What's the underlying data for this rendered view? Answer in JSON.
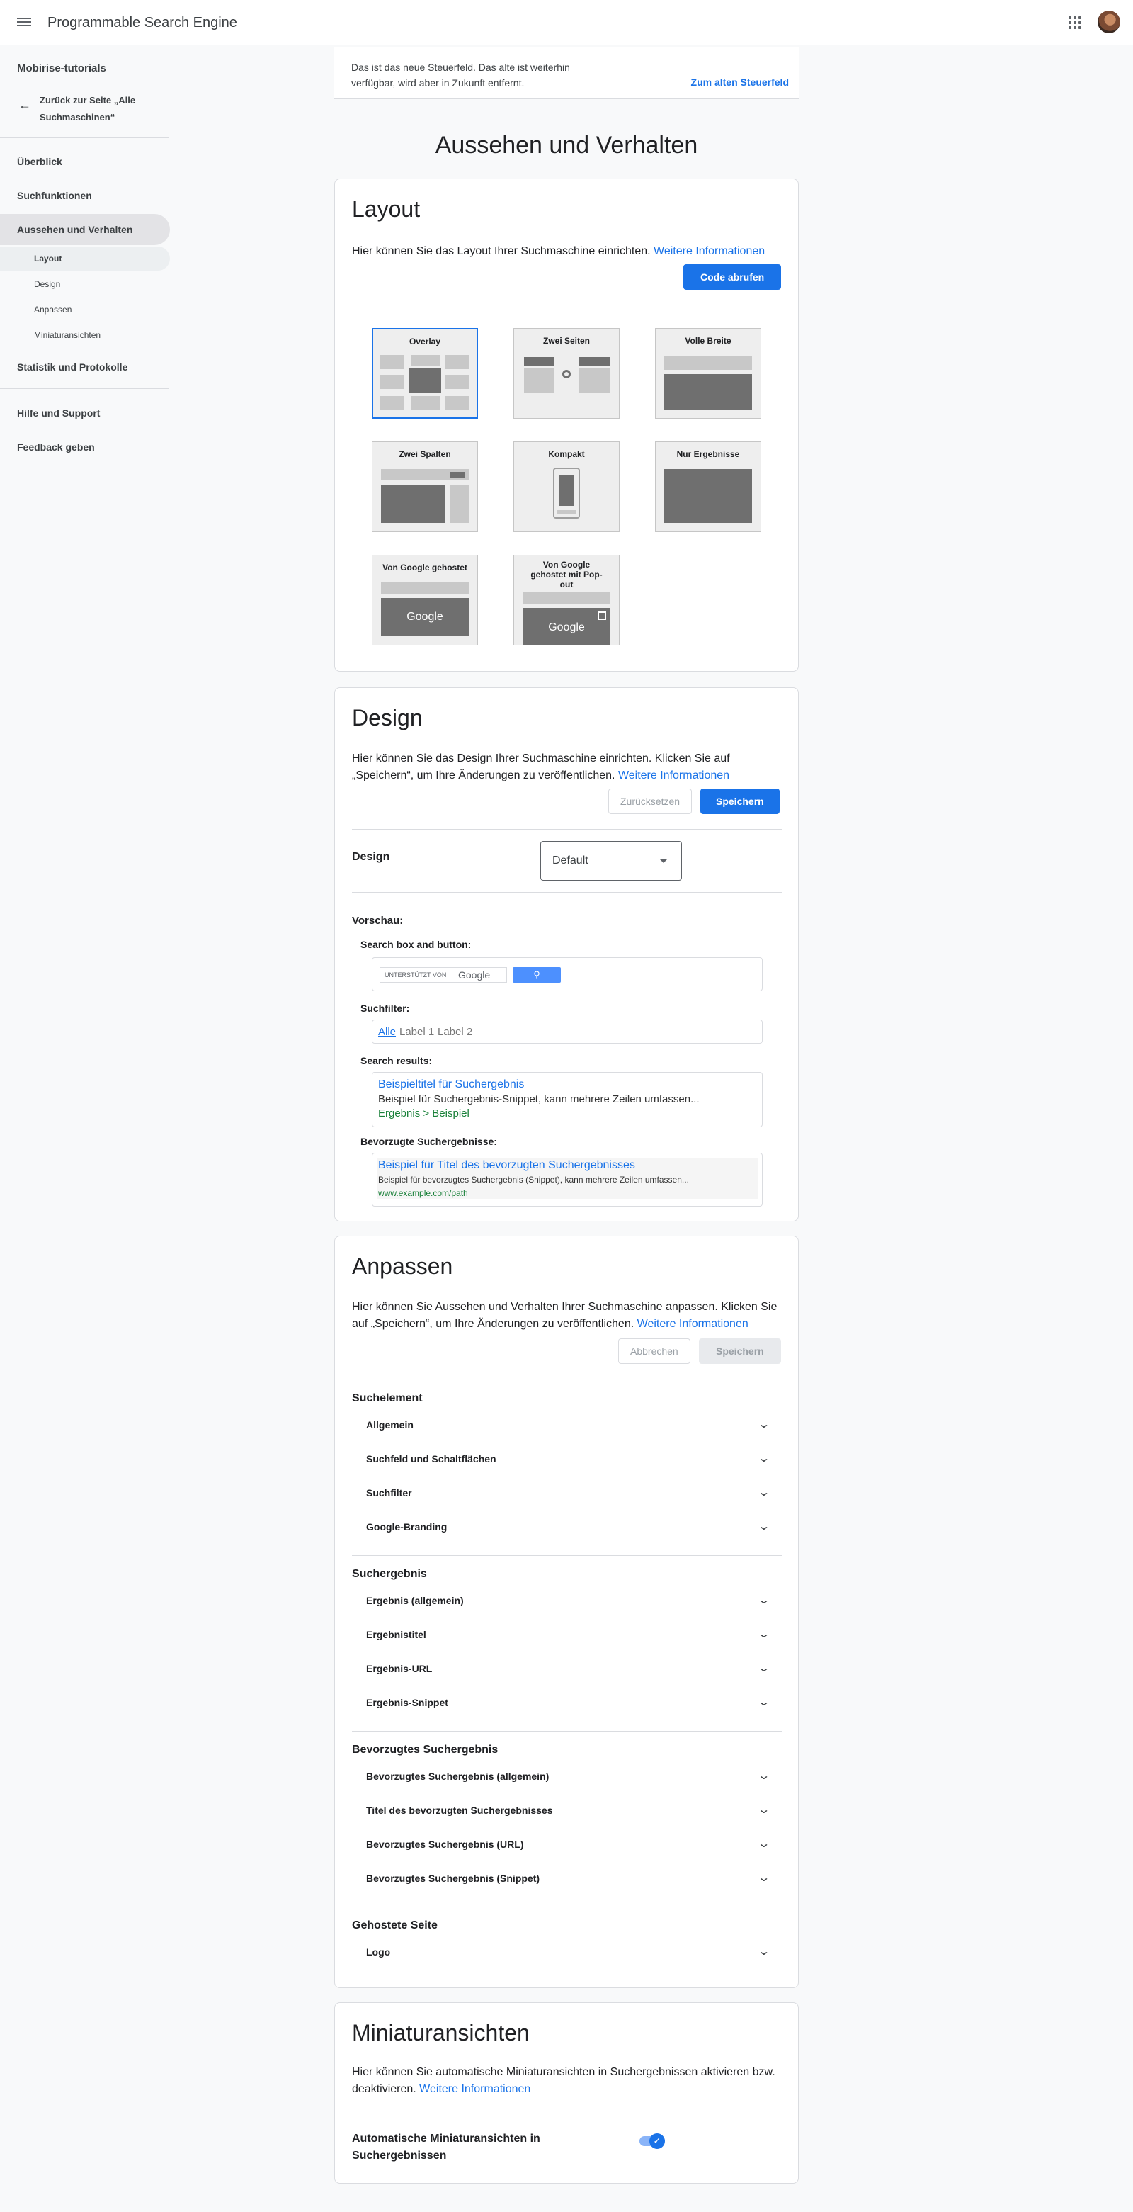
{
  "header": {
    "title": "Programmable Search Engine",
    "menu_icon": "menu-icon",
    "apps_icon": "apps-icon"
  },
  "sidebar": {
    "project": "Mobirise-tutorials",
    "back_label": "Zurück zur Seite „Alle Suchmaschinen“",
    "items": [
      {
        "label": "Überblick"
      },
      {
        "label": "Suchfunktionen"
      },
      {
        "label": "Aussehen und Verhalten"
      },
      {
        "label": "Statistik und Protokolle"
      },
      {
        "label": "Hilfe und Support"
      },
      {
        "label": "Feedback geben"
      }
    ],
    "subitems": [
      {
        "label": "Layout"
      },
      {
        "label": "Design"
      },
      {
        "label": "Anpassen"
      },
      {
        "label": "Miniaturansichten"
      }
    ]
  },
  "banner": {
    "text": "Das ist das neue Steuerfeld. Das alte ist weiterhin verfügbar, wird aber in Zukunft entfernt.",
    "link": "Zum alten Steuerfeld"
  },
  "page": {
    "title": "Aussehen und Verhalten"
  },
  "layout": {
    "title": "Layout",
    "desc": "Hier können Sie das Layout Ihrer Suchmaschine einrichten.",
    "more": "Weitere Informationen",
    "button": "Code abrufen",
    "tiles": [
      {
        "label": "Overlay"
      },
      {
        "label": "Zwei Seiten"
      },
      {
        "label": "Volle Breite"
      },
      {
        "label": "Zwei Spalten"
      },
      {
        "label": "Kompakt"
      },
      {
        "label": "Nur Ergebnisse"
      },
      {
        "label": "Von Google gehostet"
      },
      {
        "label": "Von Google gehostet mit Pop-out"
      }
    ],
    "google_word": "Google",
    "selected": "Overlay"
  },
  "design": {
    "title": "Design",
    "desc": "Hier können Sie das Design Ihrer Suchmaschine einrichten. Klicken Sie auf „Speichern“, um Ihre Änderungen zu veröffentlichen.",
    "more": "Weitere Informationen",
    "reset": "Zurücksetzen",
    "save": "Speichern",
    "field_label": "Design",
    "select_value": "Default",
    "preview_label": "Vorschau:",
    "searchbox_label": "Search box and button:",
    "powered_by": "UNTERSTÜTZT VON",
    "google_word": "Google",
    "filter_label": "Suchfilter:",
    "filters": [
      "Alle",
      "Label 1",
      "Label 2"
    ],
    "results_label": "Search results:",
    "result_title": "Beispieltitel für Suchergebnis",
    "result_snippet": "Beispiel für Suchergebnis-Snippet, kann mehrere Zeilen umfassen...",
    "result_url": "Ergebnis > Beispiel",
    "promo_label": "Bevorzugte Suchergebnisse:",
    "promo_title": "Beispiel für Titel des bevorzugten Suchergebnisses",
    "promo_snippet": "Beispiel für bevorzugtes Suchergebnis (Snippet), kann mehrere Zeilen umfassen...",
    "promo_url": "www.example.com/path"
  },
  "customize": {
    "title": "Anpassen",
    "desc": "Hier können Sie Aussehen und Verhalten Ihrer Suchmaschine anpassen. Klicken Sie auf „Speichern“, um Ihre Änderungen zu veröffentlichen.",
    "more": "Weitere Informationen",
    "cancel": "Abbrechen",
    "save": "Speichern",
    "groups": [
      {
        "heading": "Suchelement",
        "rows": [
          "Allgemein",
          "Suchfeld und Schaltflächen",
          "Suchfilter",
          "Google-Branding"
        ]
      },
      {
        "heading": "Suchergebnis",
        "rows": [
          "Ergebnis (allgemein)",
          "Ergebnistitel",
          "Ergebnis-URL",
          "Ergebnis-Snippet"
        ]
      },
      {
        "heading": "Bevorzugtes Suchergebnis",
        "rows": [
          "Bevorzugtes Suchergebnis (allgemein)",
          "Titel des bevorzugten Suchergebnisses",
          "Bevorzugtes Suchergebnis (URL)",
          "Bevorzugtes Suchergebnis (Snippet)"
        ]
      },
      {
        "heading": "Gehostete Seite",
        "rows": [
          "Logo"
        ]
      }
    ]
  },
  "thumbnails": {
    "title": "Miniaturansichten",
    "desc": "Hier können Sie automatische Miniaturansichten in Suchergebnissen aktivieren bzw. deaktivieren.",
    "more": "Weitere Informationen",
    "toggle_label": "Automatische Miniaturansichten in Suchergebnissen",
    "toggle_on": true
  },
  "colors": {
    "accent": "#1a73e8",
    "link_green": "#188038",
    "background": "#f8f9fa"
  }
}
